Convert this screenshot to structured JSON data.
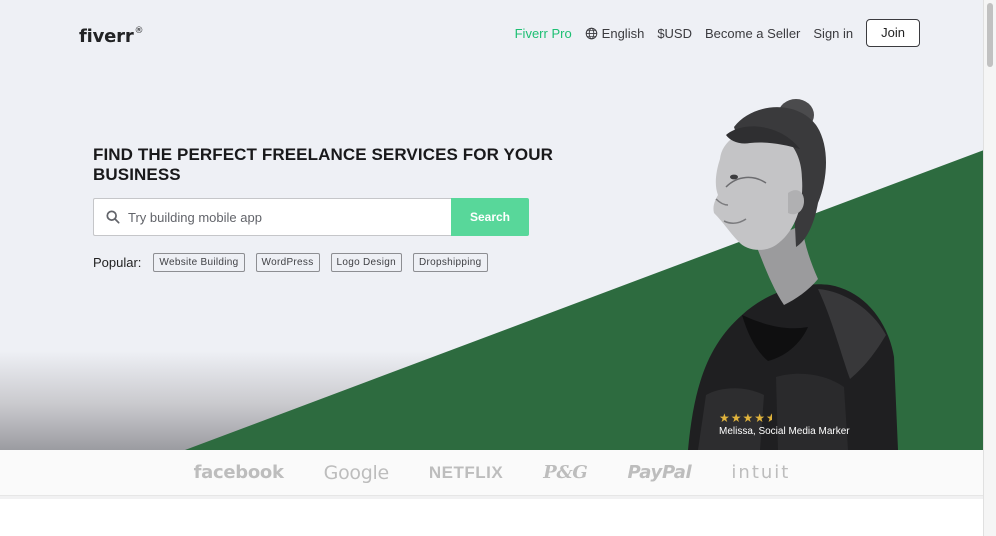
{
  "header": {
    "logo_text": "fiverr",
    "logo_mark": "®",
    "nav": {
      "pro": "Fiverr Pro",
      "language": "English",
      "currency": "$USD",
      "become_seller": "Become a Seller",
      "sign_in": "Sign in",
      "join": "Join"
    }
  },
  "hero": {
    "headline": "FIND THE PERFECT FREELANCE SERVICES FOR YOUR BUSINESS",
    "search": {
      "placeholder": "Try building mobile app",
      "button": "Search"
    },
    "popular": {
      "label": "Popular:",
      "tags": [
        "Website Building",
        "WordPress",
        "Logo Design",
        "Dropshipping"
      ]
    },
    "testimonial": {
      "rating": 4.5,
      "stars": "★★★★",
      "half_star": "★",
      "caption": "Melissa, Social Media Marker"
    },
    "colors": {
      "green": "#2d6b3f",
      "search_button": "#58d79a",
      "pro_link": "#1dbf73"
    }
  },
  "trusted_by": [
    "facebook",
    "Google",
    "NETFLIX",
    "P&G",
    "PayPal",
    "intuit"
  ],
  "icons": {
    "globe": "globe-icon",
    "search": "search-icon"
  }
}
